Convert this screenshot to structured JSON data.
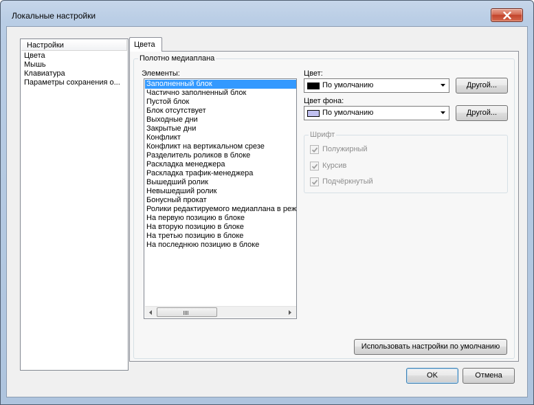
{
  "window": {
    "title": "Локальные настройки"
  },
  "nav": {
    "header": "Настройки",
    "items": [
      "Цвета",
      "Мышь",
      "Клавиатура",
      "Параметры сохранения о..."
    ]
  },
  "tabs": [
    {
      "label": "Цвета"
    }
  ],
  "panel": {
    "group_title": "Полотно медиаплана",
    "elements_label": "Элементы:",
    "elements": [
      "Заполненный блок",
      "Частично заполненный блок",
      "Пустой блок",
      "Блок отсутствует",
      "Выходные дни",
      "Закрытые дни",
      "Конфликт",
      "Конфликт на вертикальном срезе",
      "Разделитель роликов в блоке",
      "Раскладка менеджера",
      "Раскладка трафик-менеджера",
      "Вышедший ролик",
      "Невышедший ролик",
      "Бонусный прокат",
      "Ролики редактируемого медиаплана в реж",
      "На первую позицию в блоке",
      "На вторую позицию в блоке",
      "На третью позицию в блоке",
      "На последнюю позицию в блоке"
    ],
    "selected_index": 0,
    "color": {
      "label": "Цвет:",
      "value": "По умолчанию",
      "swatch": "#000000",
      "other_button": "Другой..."
    },
    "bg_color": {
      "label": "Цвет фона:",
      "value": "По умолчанию",
      "swatch": "#c0c0f0",
      "other_button": "Другой..."
    },
    "font_group": {
      "title": "Шрифт",
      "options": [
        {
          "label": "Полужирный",
          "checked": true
        },
        {
          "label": "Курсив",
          "checked": true
        },
        {
          "label": "Подчёркнутый",
          "checked": true
        }
      ]
    },
    "defaults_button": "Использовать настройки по умолчанию"
  },
  "footer": {
    "ok": "OK",
    "cancel": "Отмена"
  },
  "colors": {
    "selection": "#3399ff",
    "close_button": "#c2432b"
  }
}
